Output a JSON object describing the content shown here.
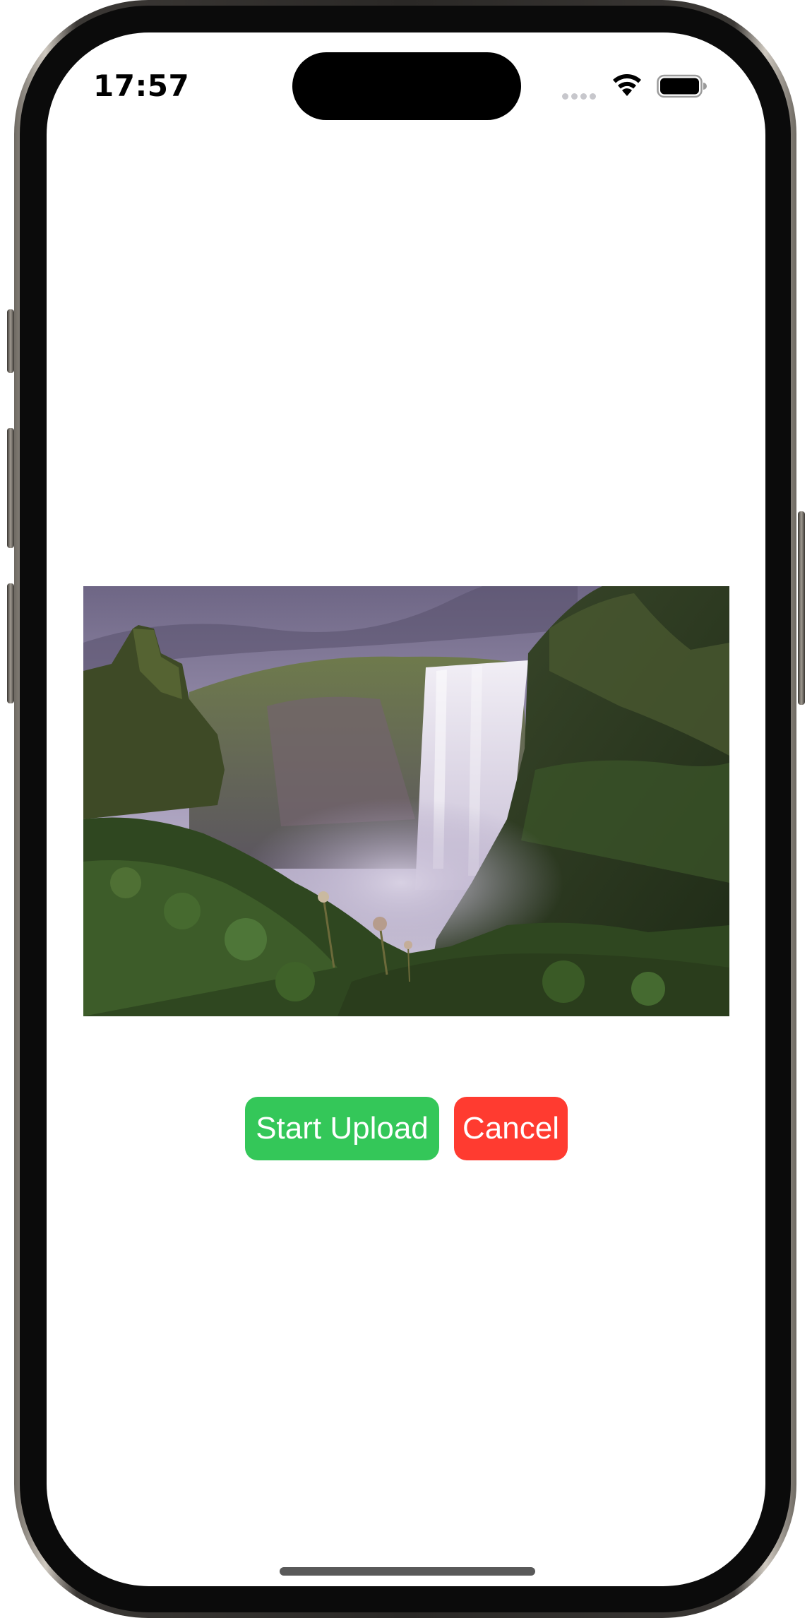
{
  "status_bar": {
    "time": "17:57",
    "icons": [
      "cellular-signal-icon",
      "wifi-icon",
      "battery-icon"
    ]
  },
  "content": {
    "image_subject": "waterfall"
  },
  "actions": {
    "start_upload_label": "Start Upload",
    "cancel_label": "Cancel"
  },
  "colors": {
    "start_upload": "#34c759",
    "cancel": "#ff3b30",
    "background": "#ffffff"
  }
}
